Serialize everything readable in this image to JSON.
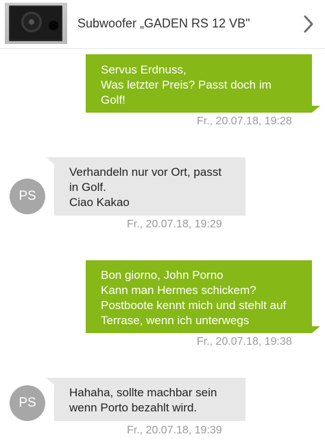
{
  "header": {
    "title": "Subwoofer „GADEN RS 12 VB\"",
    "thumbnail_icon": "subwoofer-product-photo",
    "back_icon": "chevron-right-icon"
  },
  "colors": {
    "outgoing_bubble": "#86b817",
    "incoming_bubble": "#e7e7e7",
    "timestamp": "#9a9a9a",
    "avatar": "#a7a7a7"
  },
  "messages": [
    {
      "direction": "outgoing",
      "lines": [
        "Servus Erdnuss,",
        "Was letzter Preis? Passt doch im",
        "Golf!"
      ],
      "timestamp": "Fr., 20.07.18, 19:28"
    },
    {
      "direction": "incoming",
      "avatar": "PS",
      "lines": [
        "Verhandeln nur vor Ort, passt",
        "in Golf.",
        "Ciao Kakao"
      ],
      "timestamp": "Fr., 20.07.18, 19:29"
    },
    {
      "direction": "outgoing",
      "lines": [
        "Bon giorno, John Porno",
        "Kann man Hermes schickem?",
        "Postboote kennt mich und stehlt auf",
        "Terrase, wenn ich unterwegs"
      ],
      "timestamp": "Fr., 20.07.18, 19:38"
    },
    {
      "direction": "incoming",
      "avatar": "PS",
      "lines": [
        "Hahaha, sollte machbar sein",
        "wenn Porto bezahlt wird."
      ],
      "timestamp": "Fr., 20.07.18, 19:39"
    }
  ]
}
